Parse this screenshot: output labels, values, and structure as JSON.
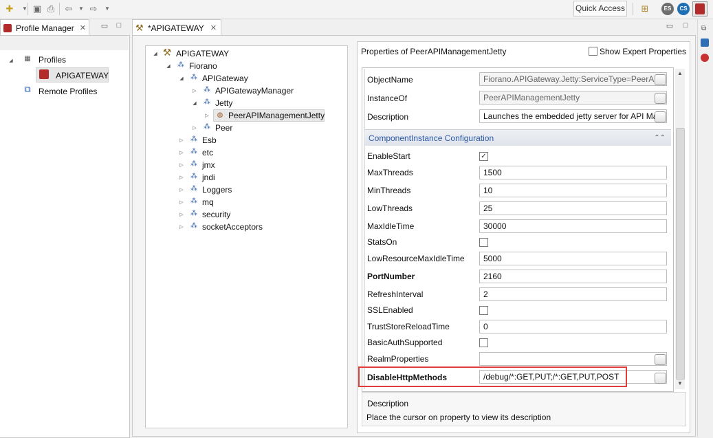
{
  "toolbar": {
    "quick_access": "Quick Access",
    "perspective1": "ES",
    "perspective2": "CS"
  },
  "profile_manager": {
    "tab_label": "Profile Manager",
    "tree": [
      {
        "label": "Profiles"
      },
      {
        "label": "APIGATEWAY"
      },
      {
        "label": "Remote Profiles"
      }
    ]
  },
  "editor": {
    "tab_label": "*APIGATEWAY",
    "tree": [
      {
        "label": "APIGATEWAY"
      },
      {
        "label": "Fiorano"
      },
      {
        "label": "APIGateway"
      },
      {
        "label": "APIGatewayManager"
      },
      {
        "label": "Jetty"
      },
      {
        "label": "PeerAPIManagementJetty"
      },
      {
        "label": "Peer"
      },
      {
        "label": "Esb"
      },
      {
        "label": "etc"
      },
      {
        "label": "jmx"
      },
      {
        "label": "jndi"
      },
      {
        "label": "Loggers"
      },
      {
        "label": "mq"
      },
      {
        "label": "security"
      },
      {
        "label": "socketAcceptors"
      }
    ]
  },
  "properties": {
    "title": "Properties of PeerAPIManagementJetty",
    "show_expert": "Show Expert Properties",
    "header_rows": [
      {
        "name": "ObjectName",
        "value": "Fiorano.APIGateway.Jetty:ServiceType=PeerAPI"
      },
      {
        "name": "InstanceOf",
        "value": "PeerAPIManagementJetty"
      },
      {
        "name": "Description",
        "value": "Launches the embedded jetty server for API Ma"
      }
    ],
    "section_title": "ComponentInstance Configuration",
    "rows": [
      {
        "name": "EnableStart",
        "value": "true"
      },
      {
        "name": "MaxThreads",
        "value": "1500"
      },
      {
        "name": "MinThreads",
        "value": "10"
      },
      {
        "name": "LowThreads",
        "value": "25"
      },
      {
        "name": "MaxIdleTime",
        "value": "30000"
      },
      {
        "name": "StatsOn",
        "value": "false"
      },
      {
        "name": "LowResourceMaxIdleTime",
        "value": "5000"
      },
      {
        "name": "PortNumber",
        "value": "2160"
      },
      {
        "name": "RefreshInterval",
        "value": "2"
      },
      {
        "name": "SSLEnabled",
        "value": "false"
      },
      {
        "name": "TrustStoreReloadTime",
        "value": "0"
      },
      {
        "name": "BasicAuthSupported",
        "value": "false"
      },
      {
        "name": "RealmProperties",
        "value": ""
      },
      {
        "name": "DisableHttpMethods",
        "value": "/debug/*:GET,PUT;/*:GET,PUT,POST"
      }
    ],
    "description_title": "Description",
    "description_text": "Place the cursor on property to view its description"
  },
  "colors": {
    "highlight_border": "#e03c3c",
    "section_text": "#2b59a5"
  }
}
